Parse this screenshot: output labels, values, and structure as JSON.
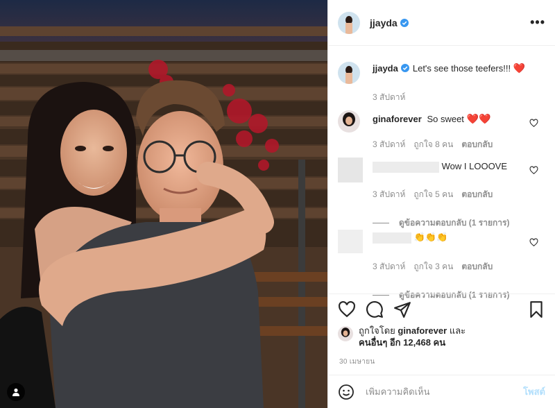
{
  "post": {
    "author": "jjayda",
    "more_label": "•••"
  },
  "caption": {
    "username": "jjayda",
    "text": "Let's see those teefers!!!",
    "heart": "❤️",
    "time": "3 สัปดาห์"
  },
  "comments": [
    {
      "username": "ginaforever",
      "text": "So sweet",
      "emoji": "❤️❤️",
      "time": "3 สัปดาห์",
      "likes": "ถูกใจ 8 คน",
      "reply_label": "ตอบกลับ"
    },
    {
      "username": "",
      "text": "Wow I LOOOVE",
      "time": "3 สัปดาห์",
      "likes": "ถูกใจ 5 คน",
      "reply_label": "ตอบกลับ",
      "view_replies": "ดูข้อความตอบกลับ (1 รายการ)"
    },
    {
      "username": "",
      "text": "👏👏👏",
      "time": "3 สัปดาห์",
      "likes": "ถูกใจ 3 คน",
      "reply_label": "ตอบกลับ",
      "view_replies": "ดูข้อความตอบกลับ (1 รายการ)"
    }
  ],
  "likes": {
    "prefix": "ถูกใจโดย",
    "user": "ginaforever",
    "and": "และ",
    "others": "คนอื่นๆ อีก 12,468 คน"
  },
  "date": "30 เมษายน",
  "add_comment": {
    "placeholder": "เพิ่มความคิดเห็น",
    "post_label": "โพสต์"
  },
  "colors": {
    "verified": "#3897f0",
    "heart": "#ed4956",
    "post_button": "#b2dffc"
  }
}
